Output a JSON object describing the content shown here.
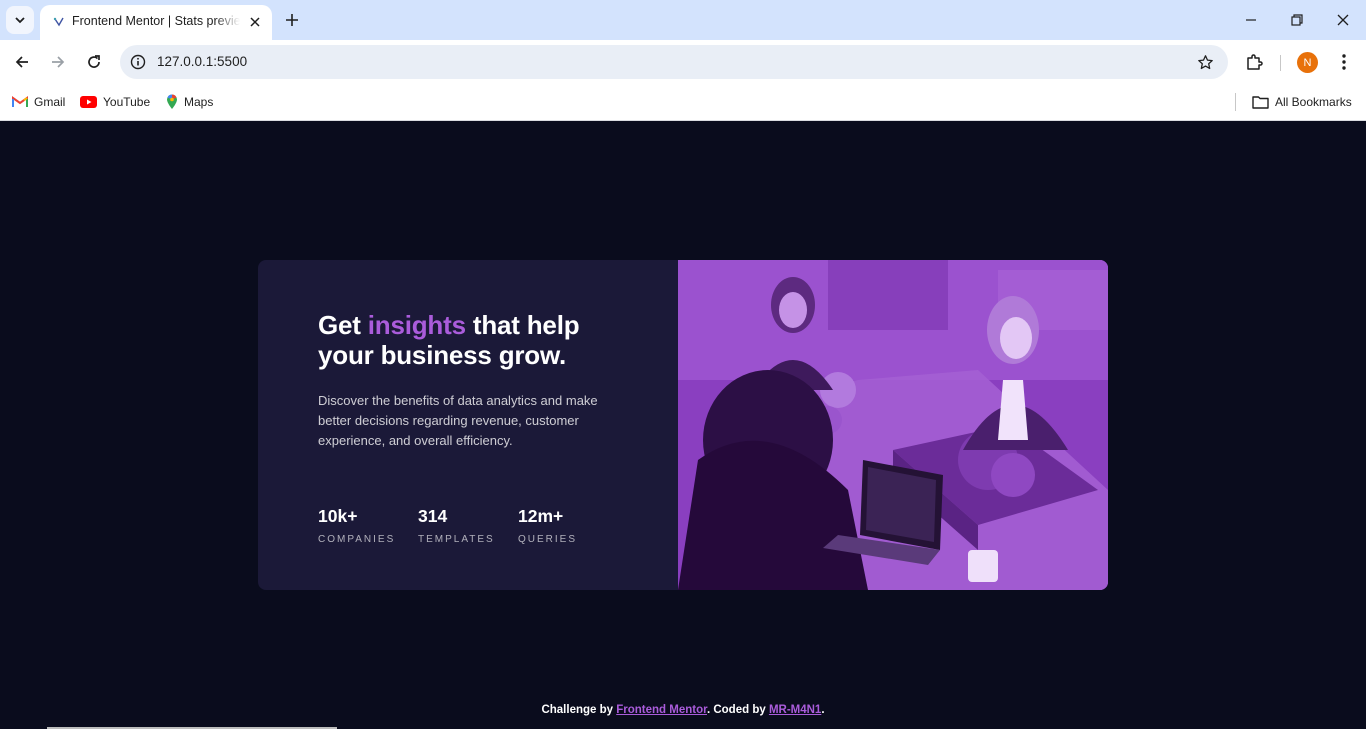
{
  "browser": {
    "tab": {
      "title": "Frontend Mentor | Stats preview card component"
    },
    "omnibox": {
      "url": "127.0.0.1:5500"
    },
    "profile": {
      "initial": "N",
      "color": "#e8710a"
    },
    "bookmarks": [
      {
        "label": "Gmail",
        "icon": "gmail-icon"
      },
      {
        "label": "YouTube",
        "icon": "youtube-icon"
      },
      {
        "label": "Maps",
        "icon": "maps-icon"
      }
    ],
    "all_bookmarks_label": "All Bookmarks"
  },
  "card": {
    "heading": {
      "before": "Get ",
      "accent": "insights",
      "after": " that help your business grow."
    },
    "description": "Discover the benefits of data analytics and make better decisions regarding revenue, customer experience, and overall efficiency.",
    "stats": [
      {
        "value": "10k+",
        "label": "COMPANIES"
      },
      {
        "value": "314",
        "label": "TEMPLATES"
      },
      {
        "value": "12m+",
        "label": "QUERIES"
      }
    ],
    "image": {
      "overlay_color": "#8d3fc2"
    }
  },
  "attribution": {
    "prefix": "Challenge by ",
    "link1": "Frontend Mentor",
    "middle": ". Coded by ",
    "link2": "MR-M4N1",
    "suffix": "."
  },
  "colors": {
    "background": "#0a0c1d",
    "card": "#1b1938",
    "accent": "#aa5cdb"
  }
}
